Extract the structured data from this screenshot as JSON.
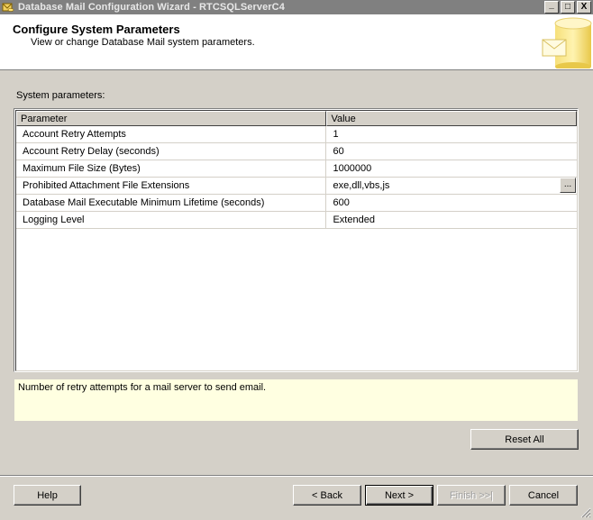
{
  "window": {
    "title": "Database Mail Configuration Wizard - RTCSQLServerC4",
    "minimize_label": "_",
    "maximize_label": "□",
    "close_label": "X"
  },
  "header": {
    "title": "Configure System Parameters",
    "subtitle": "View or change Database Mail system parameters."
  },
  "section_label": "System parameters:",
  "grid": {
    "columns": [
      "Parameter",
      "Value"
    ],
    "rows": [
      {
        "parameter": "Account Retry Attempts",
        "value": "1"
      },
      {
        "parameter": "Account Retry Delay (seconds)",
        "value": "60"
      },
      {
        "parameter": "Maximum File Size (Bytes)",
        "value": "1000000"
      },
      {
        "parameter": "Prohibited Attachment File Extensions",
        "value": "exe,dll,vbs,js",
        "has_button": true,
        "button_label": "..."
      },
      {
        "parameter": "Database Mail Executable Minimum Lifetime (seconds)",
        "value": "600"
      },
      {
        "parameter": "Logging Level",
        "value": "Extended"
      }
    ]
  },
  "description": "Number of retry attempts for a mail server to send email.",
  "buttons": {
    "reset_all": "Reset All",
    "help": "Help",
    "back": "< Back",
    "next": "Next >",
    "finish": "Finish >>|",
    "cancel": "Cancel"
  },
  "colors": {
    "titlebar_inactive": "#808080",
    "dialog_bg": "#d4d0c8",
    "description_bg": "#ffffe1",
    "header_bg": "#ffffff"
  }
}
